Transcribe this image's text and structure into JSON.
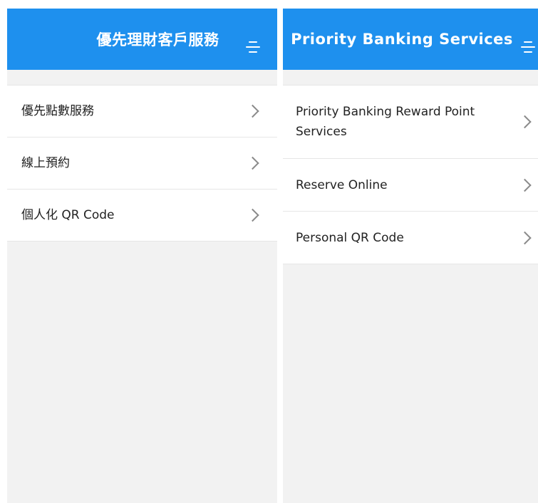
{
  "screens": [
    {
      "title": "優先理財客戶服務",
      "menu_icon": "menu-icon",
      "items": [
        {
          "label": "優先點數服務"
        },
        {
          "label": "線上預約"
        },
        {
          "label": "個人化 QR Code"
        }
      ]
    },
    {
      "title": "Priority Banking Services",
      "menu_icon": "menu-icon",
      "items": [
        {
          "label": "Priority Banking Reward Point Services"
        },
        {
          "label": "Reserve Online"
        },
        {
          "label": "Personal QR Code"
        }
      ]
    }
  ],
  "colors": {
    "header": "#1e90ee",
    "background": "#f2f2f2",
    "chevron": "#8a8a8a"
  }
}
